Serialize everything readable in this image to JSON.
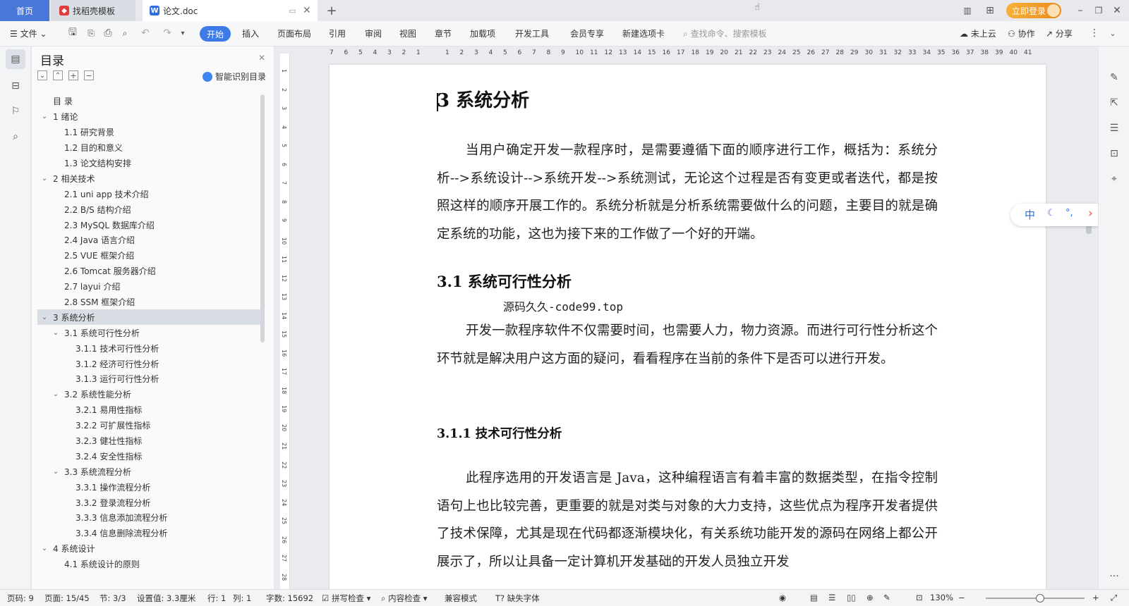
{
  "tabs": {
    "home": "首页",
    "template": "找稻壳模板",
    "document": "论文.doc"
  },
  "titlebar": {
    "login_label": "立即登录",
    "icons": [
      "add-tab-icon",
      "layout-icon",
      "grid-icon",
      "minimize-icon",
      "restore-icon",
      "close-icon"
    ]
  },
  "menubar": {
    "file": "文件",
    "start": "开始",
    "items": [
      "插入",
      "页面布局",
      "引用",
      "审阅",
      "视图",
      "章节",
      "加载项",
      "开发工具",
      "会员专享",
      "新建选项卡"
    ],
    "search_placeholder": "查找命令、搜索模板",
    "cloud": "未上云",
    "collab": "协作",
    "share": "分享"
  },
  "toc": {
    "title": "目录",
    "smart_label": "智能识别目录",
    "items": [
      {
        "label": "目 录",
        "level": 1,
        "chev": ""
      },
      {
        "label": "1 绪论",
        "level": 1,
        "chev": "⌄"
      },
      {
        "label": "1.1 研究背景",
        "level": 2,
        "chev": ""
      },
      {
        "label": "1.2 目的和意义",
        "level": 2,
        "chev": ""
      },
      {
        "label": "1.3 论文结构安排",
        "level": 2,
        "chev": ""
      },
      {
        "label": "2 相关技术",
        "level": 1,
        "chev": "⌄"
      },
      {
        "label": "2.1 uni app 技术介绍",
        "level": 2,
        "chev": ""
      },
      {
        "label": "2.2 B/S 结构介绍",
        "level": 2,
        "chev": ""
      },
      {
        "label": "2.3 MySQL 数据库介绍",
        "level": 2,
        "chev": ""
      },
      {
        "label": "2.4 Java 语言介绍",
        "level": 2,
        "chev": ""
      },
      {
        "label": "2.5 VUE 框架介绍",
        "level": 2,
        "chev": ""
      },
      {
        "label": "2.6 Tomcat 服务器介绍",
        "level": 2,
        "chev": ""
      },
      {
        "label": "2.7 layui 介绍",
        "level": 2,
        "chev": ""
      },
      {
        "label": "2.8 SSM 框架介绍",
        "level": 2,
        "chev": ""
      },
      {
        "label": "3 系统分析",
        "level": 1,
        "chev": "⌄",
        "active": true
      },
      {
        "label": "3.1 系统可行性分析",
        "level": 2,
        "chev": "⌄"
      },
      {
        "label": "3.1.1 技术可行性分析",
        "level": 3,
        "chev": ""
      },
      {
        "label": "3.1.2 经济可行性分析",
        "level": 3,
        "chev": ""
      },
      {
        "label": "3.1.3 运行可行性分析",
        "level": 3,
        "chev": ""
      },
      {
        "label": "3.2 系统性能分析",
        "level": 2,
        "chev": "⌄"
      },
      {
        "label": "3.2.1 易用性指标",
        "level": 3,
        "chev": ""
      },
      {
        "label": "3.2.2 可扩展性指标",
        "level": 3,
        "chev": ""
      },
      {
        "label": "3.2.3 健壮性指标",
        "level": 3,
        "chev": ""
      },
      {
        "label": "3.2.4 安全性指标",
        "level": 3,
        "chev": ""
      },
      {
        "label": "3.3 系统流程分析",
        "level": 2,
        "chev": "⌄"
      },
      {
        "label": "3.3.1 操作流程分析",
        "level": 3,
        "chev": ""
      },
      {
        "label": "3.3.2 登录流程分析",
        "level": 3,
        "chev": ""
      },
      {
        "label": "3.3.3 信息添加流程分析",
        "level": 3,
        "chev": ""
      },
      {
        "label": "3.3.4 信息删除流程分析",
        "level": 3,
        "chev": ""
      },
      {
        "label": "4 系统设计",
        "level": 1,
        "chev": "⌄"
      },
      {
        "label": "4.1 系统设计的原则",
        "level": 2,
        "chev": ""
      }
    ]
  },
  "ruler": {
    "h": [
      "7",
      "6",
      "5",
      "4",
      "3",
      "2",
      "1",
      "",
      "1",
      "2",
      "3",
      "4",
      "5",
      "6",
      "7",
      "8",
      "9",
      "10",
      "11",
      "12",
      "13",
      "14",
      "15",
      "16",
      "17",
      "18",
      "19",
      "20",
      "21",
      "22",
      "23",
      "24",
      "25",
      "26",
      "27",
      "28",
      "29",
      "30",
      "31",
      "32",
      "33",
      "34",
      "35",
      "36",
      "37",
      "38",
      "39",
      "40",
      "41"
    ],
    "v": [
      "1",
      "2",
      "3",
      "4",
      "5",
      "6",
      "7",
      "8",
      "9",
      "10",
      "11",
      "12",
      "13",
      "14",
      "15",
      "16",
      "17",
      "18",
      "19",
      "20",
      "21",
      "22",
      "23",
      "24",
      "25",
      "26",
      "27",
      "28"
    ]
  },
  "document": {
    "h1": "3  系统分析",
    "p1": "当用户确定开发一款程序时，是需要遵循下面的顺序进行工作，概括为：系统分析-->系统设计-->系统开发-->系统测试，无论这个过程是否有变更或者迭代，都是按照这样的顺序开展工作的。系统分析就是分析系统需要做什么的问题，主要目的就是确定系统的功能，这也为接下来的工作做了一个好的开端。",
    "h2": "3.1  系统可行性分析",
    "watermark": "源码久久-code99.top",
    "p2": "开发一款程序软件不仅需要时间，也需要人力，物力资源。而进行可行性分析这个环节就是解决用户这方面的疑问，看看程序在当前的条件下是否可以进行开发。",
    "h3": "3.1.1  技术可行性分析",
    "p3": "此程序选用的开发语言是 Java，这种编程语言有着丰富的数据类型，在指令控制语句上也比较完善，更重要的就是对类与对象的大力支持，这些优点为程序开发者提供了技术保障，尤其是现在代码都逐渐模块化，有关系统功能开发的源码在网络上都公开展示了，所以让具备一定计算机开发基础的开发人员独立开发"
  },
  "ime": {
    "lang": "中"
  },
  "statusbar": {
    "page_code": "页码: 9",
    "pages": "页面: 15/45",
    "section": "节: 3/3",
    "setting": "设置值: 3.3厘米",
    "row": "行: 1",
    "col": "列: 1",
    "words": "字数: 15692",
    "spell": "拼写检查",
    "content_check": "内容检查",
    "compat": "兼容模式",
    "missing_font": "缺失字体",
    "zoom": "130%",
    "zoom_value": 0.55
  }
}
